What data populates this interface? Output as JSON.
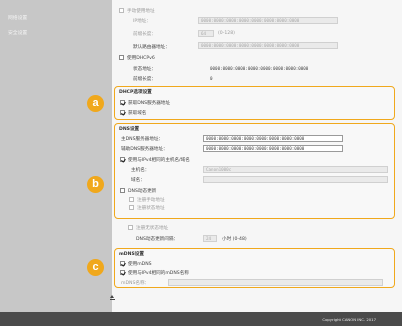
{
  "sidebar": {
    "items": [
      {
        "label": "网络设置"
      },
      {
        "label": "安全设置"
      }
    ]
  },
  "ipv6_section": {
    "manual_checkbox_label": "手动使用地址",
    "ip_address_label": "IP地址：",
    "ip_address_value": "0000:0000:0000:0000:0000:0000:0000:0000",
    "prefix_length_label": "前缀长度：",
    "prefix_length_value": "64",
    "prefix_length_range": "(0-128)",
    "default_gateway_label": "默认路由器地址：",
    "default_gateway_value": "0000:0000:0000:0000:0000:0000:0000:0000",
    "dhcpv6_checkbox_label": "使用DHCPv6",
    "stateful_address_label": "状态地址：",
    "stateful_address_value": "0000:0000:0000:0000:0000:0000:0000:0000",
    "stateful_prefix_label": "前缀长度：",
    "stateful_prefix_value": "0"
  },
  "dhcp_options": {
    "title": "DHCP选项设置",
    "badge": "a",
    "get_dns_label": "获取DNS服务器地址",
    "get_dns_checked": true,
    "get_domain_label": "获取域名",
    "get_domain_checked": true
  },
  "dns_settings": {
    "title": "DNS设置",
    "badge": "b",
    "primary_dns_label": "主DNS服务器地址：",
    "primary_dns_value": "0000:0000:0000:0000:0000:0000:0000:0000",
    "secondary_dns_label": "辅助DNS服务器地址：",
    "secondary_dns_value": "0000:0000:0000:0000:0000:0000:0000:0000",
    "use_same_host_label": "使用与IPv4相同的主机名/域名",
    "use_same_host_checked": true,
    "host_name_label": "主机名：",
    "host_name_value": "Canon1000c",
    "domain_name_label": "域名：",
    "domain_name_value": "",
    "dns_dynamic_update_label": "DNS动态更新",
    "dns_dynamic_update_checked": false,
    "register_manual_label": "注册手动地址",
    "register_stateful_label": "注册状态地址",
    "register_stateless_label": "注册无状态地址",
    "update_interval_label": "DNS动态更新间隔：",
    "update_interval_value": "24",
    "update_interval_unit": "小时 (0-48)"
  },
  "mdns_settings": {
    "title": "mDNS设置",
    "badge": "c",
    "use_mdns_label": "使用mDNS",
    "use_mdns_checked": true,
    "use_same_mdns_label": "使用与IPv4相同的mDNS名称",
    "use_same_mdns_checked": true,
    "mdns_name_label": "mDNS名称：",
    "mdns_name_value": ""
  },
  "footer": {
    "copyright": "Copyright CANON INC. 2017"
  },
  "colors": {
    "accent": "#f0a81c",
    "sidebar": "#c7c7c7",
    "footer": "#4b4b4b"
  }
}
